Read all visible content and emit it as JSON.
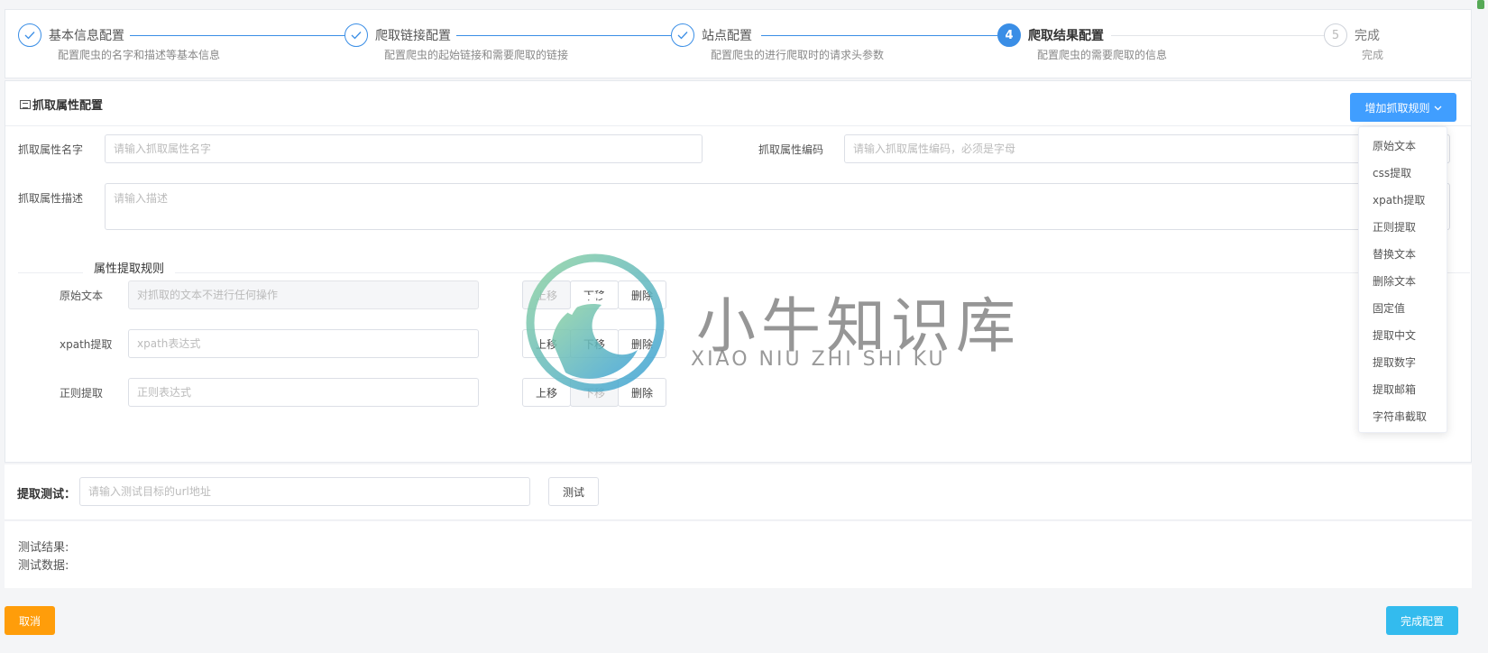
{
  "steps": [
    {
      "title": "基本信息配置",
      "desc": "配置爬虫的名字和描述等基本信息",
      "state": "done"
    },
    {
      "title": "爬取链接配置",
      "desc": "配置爬虫的起始链接和需要爬取的链接",
      "state": "done"
    },
    {
      "title": "站点配置",
      "desc": "配置爬虫的进行爬取时的请求头参数",
      "state": "done"
    },
    {
      "title": "爬取结果配置",
      "desc": "配置爬虫的需要爬取的信息",
      "state": "active",
      "num": "4"
    },
    {
      "title": "完成",
      "desc": "完成",
      "state": "wait",
      "num": "5"
    }
  ],
  "panel": {
    "title": "抓取属性配置",
    "add_rule_button": "增加抓取规则"
  },
  "form": {
    "name_label": "抓取属性名字",
    "name_placeholder": "请输入抓取属性名字",
    "code_label": "抓取属性编码",
    "code_placeholder": "请输入抓取属性编码，必须是字母",
    "desc_label": "抓取属性描述",
    "desc_placeholder": "请输入描述"
  },
  "rules": {
    "section_title": "属性提取规则",
    "items": [
      {
        "label": "原始文本",
        "placeholder": "对抓取的文本不进行任何操作",
        "up": "上移",
        "down": "下移",
        "delete": "删除"
      },
      {
        "label": "xpath提取",
        "placeholder": "xpath表达式",
        "up": "上移",
        "down": "下移",
        "delete": "删除"
      },
      {
        "label": "正则提取",
        "placeholder": "正则表达式",
        "up": "上移",
        "down": "下移",
        "delete": "删除"
      }
    ]
  },
  "dropdown": {
    "items": [
      "原始文本",
      "css提取",
      "xpath提取",
      "正则提取",
      "替换文本",
      "删除文本",
      "固定值",
      "提取中文",
      "提取数字",
      "提取邮箱",
      "字符串截取"
    ]
  },
  "test": {
    "label": "提取测试：",
    "placeholder": "请输入测试目标的url地址",
    "button": "测试",
    "result_label": "测试结果:",
    "data_label": "测试数据:"
  },
  "footer": {
    "cancel": "取消",
    "finish": "完成配置"
  },
  "watermark": {
    "cn": "小牛知识库",
    "en": "XIAO NIU ZHI SHI KU"
  },
  "colors": {
    "primary": "#409eff",
    "step": "#3a8ee6",
    "cancel": "#ff9d0a",
    "finish": "#33bbee"
  }
}
